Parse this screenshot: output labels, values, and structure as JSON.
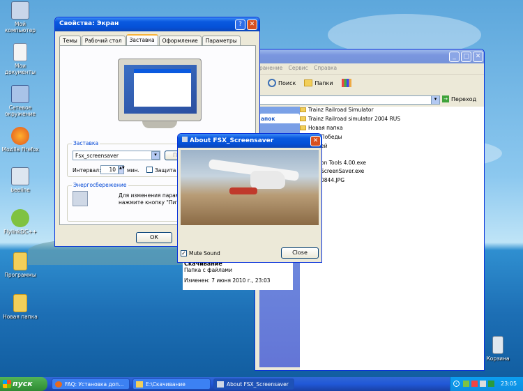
{
  "desktop": {
    "icons": [
      {
        "label": "Мой компьютер"
      },
      {
        "label": "Мои документы"
      },
      {
        "label": "Сетевое окружение"
      },
      {
        "label": "Mozilla Firefox"
      },
      {
        "label": "beeline"
      },
      {
        "label": "FlylinkDC++"
      },
      {
        "label": "Программы"
      },
      {
        "label": "Новая папка"
      },
      {
        "label": "Корзина"
      }
    ]
  },
  "props": {
    "title": "Свойства: Экран",
    "tabs": [
      "Темы",
      "Рабочий стол",
      "Заставка",
      "Оформление",
      "Параметры"
    ],
    "screensaver_group": "Заставка",
    "screensaver_value": "Fsx_screensaver",
    "params_label": "Пар",
    "interval_label": "Интервал:",
    "interval_value": "10",
    "interval_unit": "мин.",
    "protect_label": "Защита п",
    "energy_group": "Энергосбережение",
    "energy_text_1": "Для изменения параме",
    "energy_text_2": "нажмите кнопку \"Питан",
    "ok": "ОК"
  },
  "explorer": {
    "menu": [
      "ранение",
      "Сервис",
      "Справка"
    ],
    "search": "Поиск",
    "folders": "Папки",
    "go": "Переход",
    "sidebar_header": "апок",
    "files": [
      "Trainz Railroad Simulator",
      "Trainz Railroad simulator 2004 RUS",
      "Новая папка",
      "Победы",
      "ей",
      "on Tools 4.00.exe",
      "ScreenSaver.exe",
      "0844.JPG"
    ],
    "details_title": "Скачивание",
    "details_type": "Папка с файлами",
    "details_modified": "Изменен: 7 июня 2010 г., 23:03"
  },
  "about": {
    "title": "About FSX_Screensaver",
    "mute": "Mute Sound",
    "close": "Close"
  },
  "taskbar": {
    "start": "пуск",
    "tasks": [
      "FAQ: Установка доп...",
      "E:\\Скачивание",
      "About FSX_Screensaver"
    ],
    "clock": "23:05"
  },
  "colors": {
    "accent": "#0a5ae0",
    "start": "#3c9b3f",
    "close": "#d8501f"
  }
}
